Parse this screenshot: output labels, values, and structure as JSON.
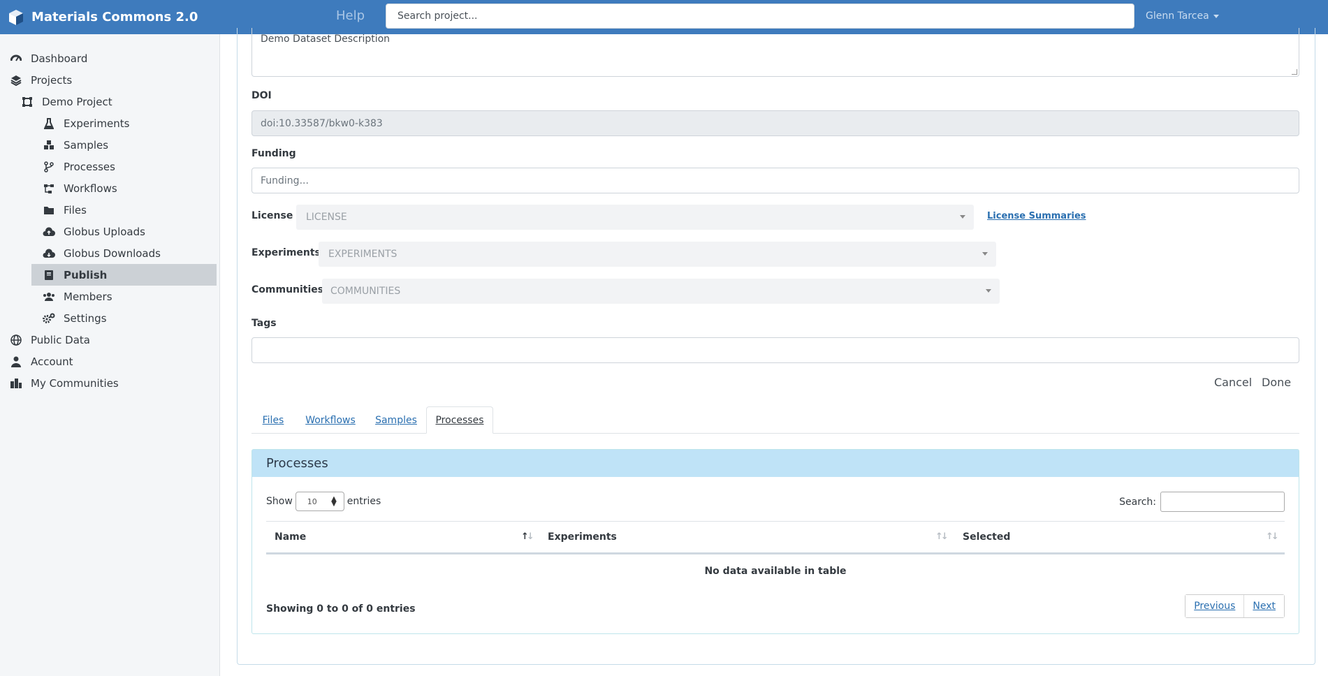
{
  "app": {
    "title": "Materials Commons 2.0"
  },
  "header": {
    "help": "Help",
    "search_placeholder": "Search project...",
    "user": "Glenn Tarcea"
  },
  "sidebar": {
    "items": [
      {
        "label": "Dashboard",
        "icon": "dashboard-icon"
      },
      {
        "label": "Projects",
        "icon": "layers-icon"
      },
      {
        "label": "Demo Project",
        "icon": "project-icon"
      },
      {
        "label": "Experiments",
        "icon": "flask-icon"
      },
      {
        "label": "Samples",
        "icon": "cubes-icon"
      },
      {
        "label": "Processes",
        "icon": "branch-icon"
      },
      {
        "label": "Workflows",
        "icon": "workflow-icon"
      },
      {
        "label": "Files",
        "icon": "folder-icon"
      },
      {
        "label": "Globus Uploads",
        "icon": "cloud-upload-icon"
      },
      {
        "label": "Globus Downloads",
        "icon": "cloud-download-icon"
      },
      {
        "label": "Publish",
        "icon": "book-icon"
      },
      {
        "label": "Members",
        "icon": "users-icon"
      },
      {
        "label": "Settings",
        "icon": "cogs-icon"
      },
      {
        "label": "Public Data",
        "icon": "globe-icon"
      },
      {
        "label": "Account",
        "icon": "user-icon"
      },
      {
        "label": "My Communities",
        "icon": "city-icon"
      }
    ],
    "active": "Publish"
  },
  "form": {
    "description_value": "Demo Dataset Description",
    "doi_label": "DOI",
    "doi_value": "doi:10.33587/bkw0-k383",
    "funding_label": "Funding",
    "funding_placeholder": "Funding...",
    "license_label": "License",
    "license_value": "LICENSE",
    "license_summaries": "License Summaries",
    "experiments_label": "Experiments",
    "experiments_value": "EXPERIMENTS",
    "communities_label": "Communities",
    "communities_value": "COMMUNITIES",
    "tags_label": "Tags",
    "cancel": "Cancel",
    "done": "Done"
  },
  "tabs": [
    "Files",
    "Workflows",
    "Samples",
    "Processes"
  ],
  "active_tab": "Processes",
  "processes": {
    "title": "Processes",
    "show": "Show",
    "page_length": "10",
    "entries": "entries",
    "search_label": "Search:",
    "columns": [
      "Name",
      "Experiments",
      "Selected"
    ],
    "empty": "No data available in table",
    "info": "Showing 0 to 0 of 0 entries",
    "previous": "Previous",
    "next": "Next"
  }
}
